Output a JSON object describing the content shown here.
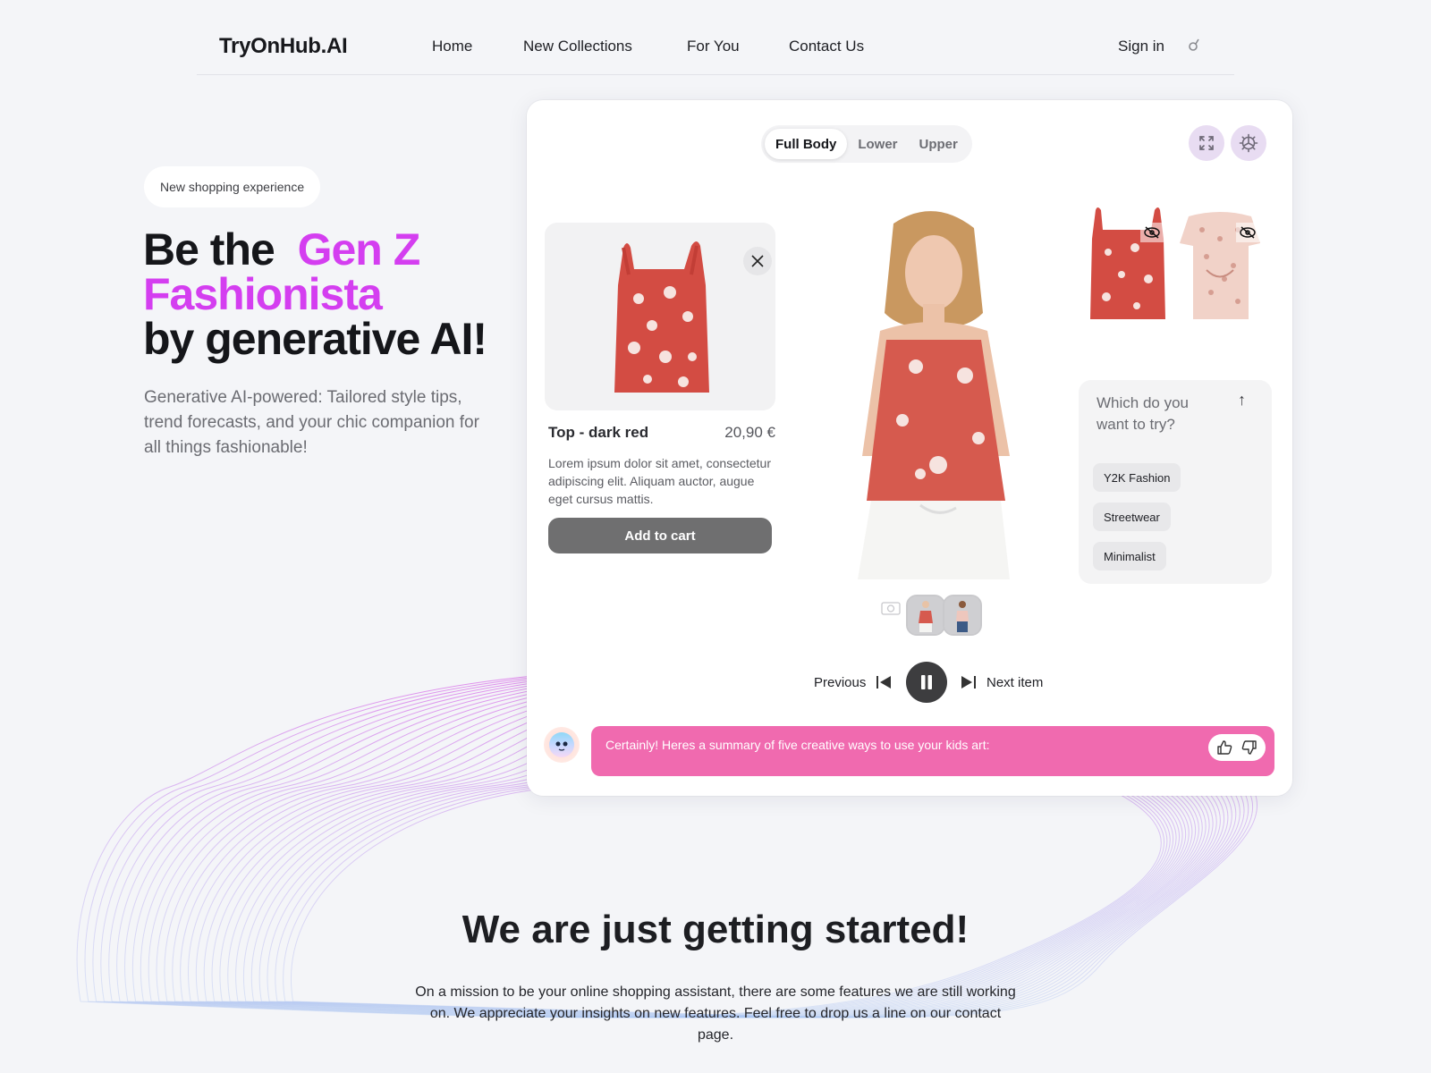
{
  "nav": {
    "logo": "TryOnHub.AI",
    "links": [
      "Home",
      "New Collections",
      "For You",
      "Contact Us"
    ],
    "sign_in": "Sign in",
    "user_icon": "profile-icon"
  },
  "hero": {
    "badge": "New shopping experience",
    "headline_part1": "Be the",
    "headline_accent1": "Gen Z",
    "headline_accent2": "Fashionista",
    "headline_part2": "by generative AI!",
    "subtext": "Generative AI-powered: Tailored style tips, trend forecasts, and your chic companion for all things fashionable!",
    "accent_color": "#d43ef0"
  },
  "tryon": {
    "tabs": [
      {
        "label": "Full Body",
        "active": true
      },
      {
        "label": "Lower",
        "active": false
      },
      {
        "label": "Upper",
        "active": false
      }
    ],
    "icons": {
      "expand": "expand-icon",
      "settings": "settings-gear-icon"
    },
    "product": {
      "title": "Top - dark red",
      "price": "20,90 €",
      "description": "Lorem ipsum dolor sit amet, consectetur adipiscing elit. Aliquam auctor, augue eget cursus mattis.",
      "add_to_cart": "Add to cart"
    },
    "alternatives": [
      {
        "name": "red floral cami top",
        "hidden_icon": "eye-off-icon"
      },
      {
        "name": "pink leopard twist top",
        "hidden_icon": "eye-off-icon"
      }
    ],
    "suggestion": {
      "question": "Which do you want to try?",
      "chips": [
        "Y2K Fashion",
        "Streetwear",
        "Minimalist"
      ]
    },
    "controls": {
      "previous": "Previous",
      "next": "Next item",
      "state": "playing"
    },
    "chat": {
      "message": "Certainly! Heres a summary of five creative ways to use your kids art:",
      "bubble_color": "#f06aaf"
    }
  },
  "bottom": {
    "title": "We are just getting started!",
    "text": "On a mission to be your online shopping assistant, there are some features we are still working on. We appreciate your insights on new features. Feel free to drop us a line on our contact page."
  }
}
